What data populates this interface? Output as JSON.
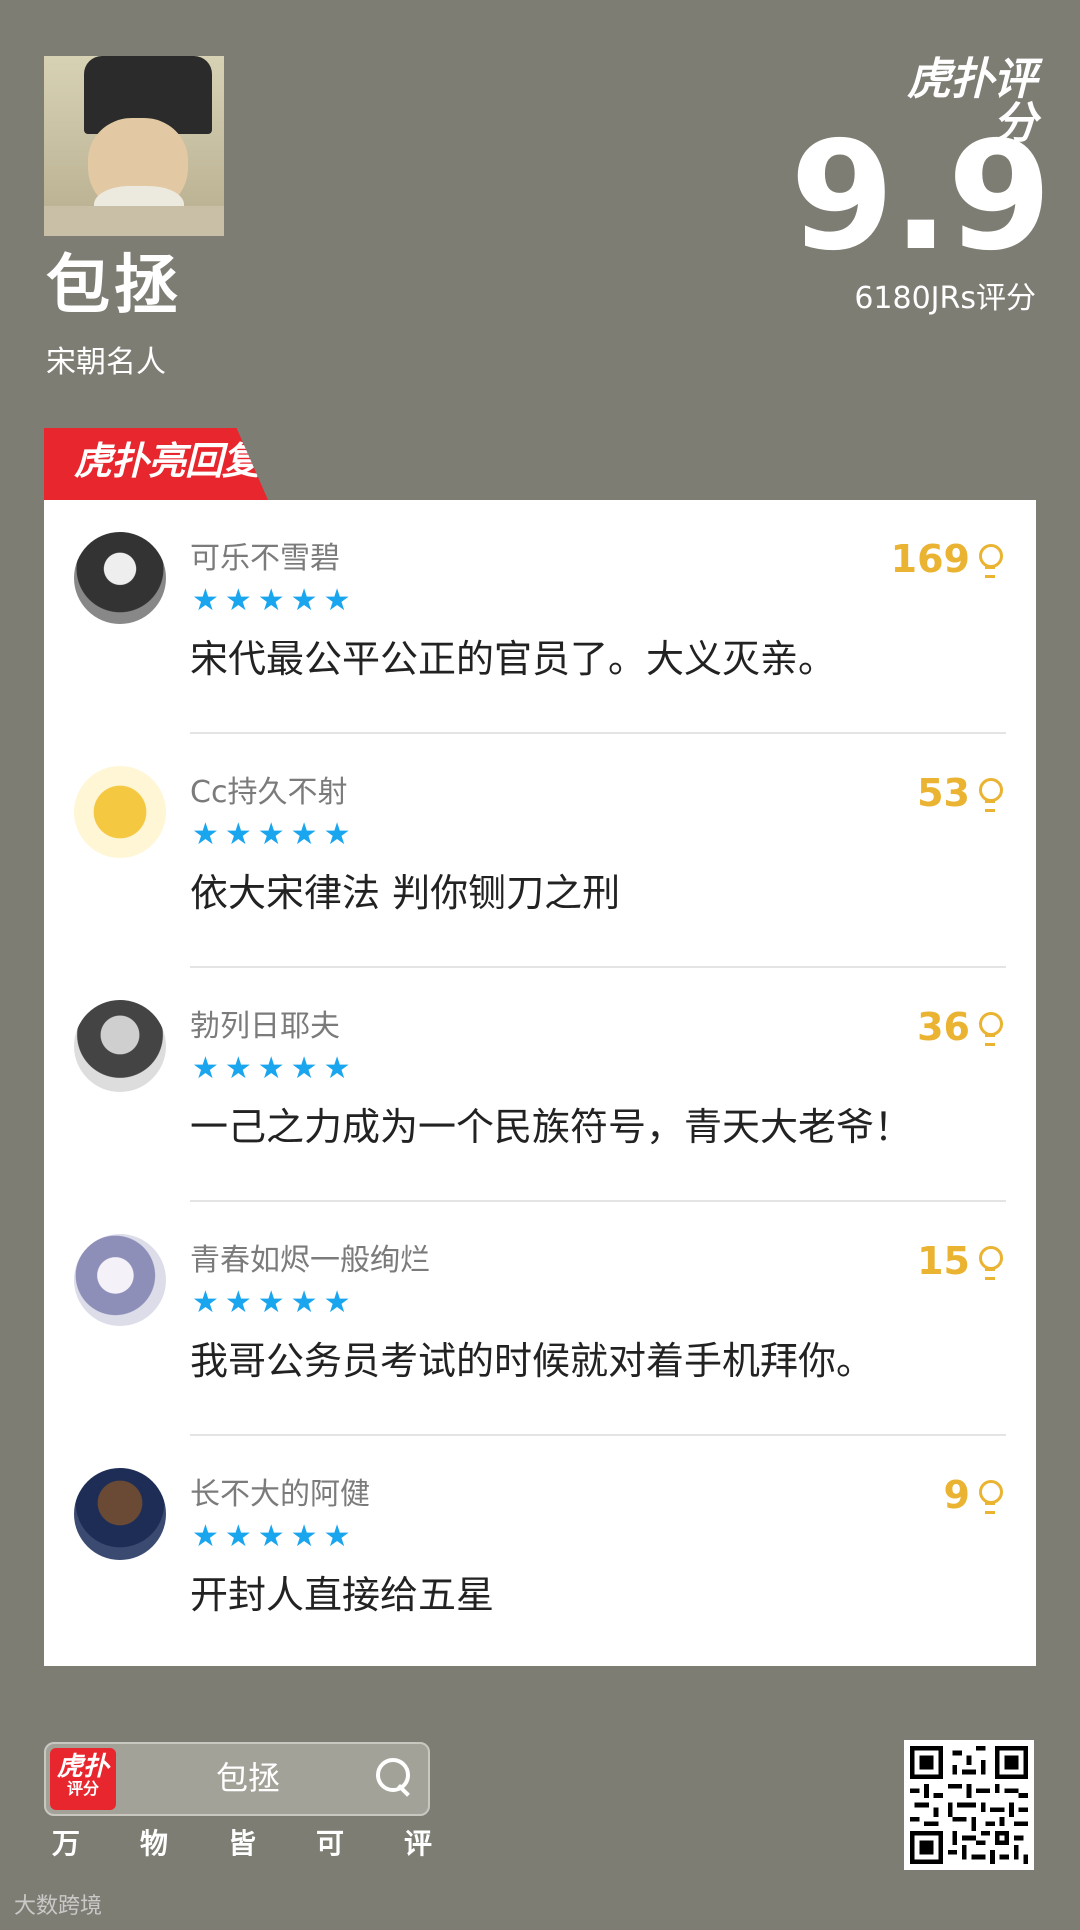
{
  "profile": {
    "name": "包拯",
    "subtitle": "宋朝名人"
  },
  "rating": {
    "brand": "虎扑评分",
    "score": "9.9",
    "raters": "6180JRs评分"
  },
  "section_tag": "虎扑亮回复",
  "reviews": [
    {
      "username": "可乐不雪碧",
      "stars": "★★★★★",
      "rating_stars": 5,
      "likes": "169",
      "comment": "宋代最公平公正的官员了。大义灭亲。"
    },
    {
      "username": "Cc持久不射",
      "stars": "★★★★★",
      "rating_stars": 5,
      "likes": "53",
      "comment": "依大宋律法 判你铡刀之刑"
    },
    {
      "username": "勃列日耶夫",
      "stars": "★★★★★",
      "rating_stars": 5,
      "likes": "36",
      "comment": "一己之力成为一个民族符号，青天大老爷！"
    },
    {
      "username": "青春如烬一般绚烂",
      "stars": "★★★★★",
      "rating_stars": 5,
      "likes": "15",
      "comment": "我哥公务员考试的时候就对着手机拜你。"
    },
    {
      "username": "长不大的阿健",
      "stars": "★★★★★",
      "rating_stars": 5,
      "likes": "9",
      "comment": "开封人直接给五星"
    }
  ],
  "search": {
    "logo_top": "虎扑",
    "logo_bottom": "评分",
    "query": "包拯"
  },
  "slogan": [
    "万",
    "物",
    "皆",
    "可",
    "评"
  ],
  "watermark": "大数跨境",
  "colors": {
    "background": "#7e7d74",
    "brand_red": "#e8262e",
    "star_blue": "#1aa6ef",
    "like_gold": "#eab331"
  }
}
